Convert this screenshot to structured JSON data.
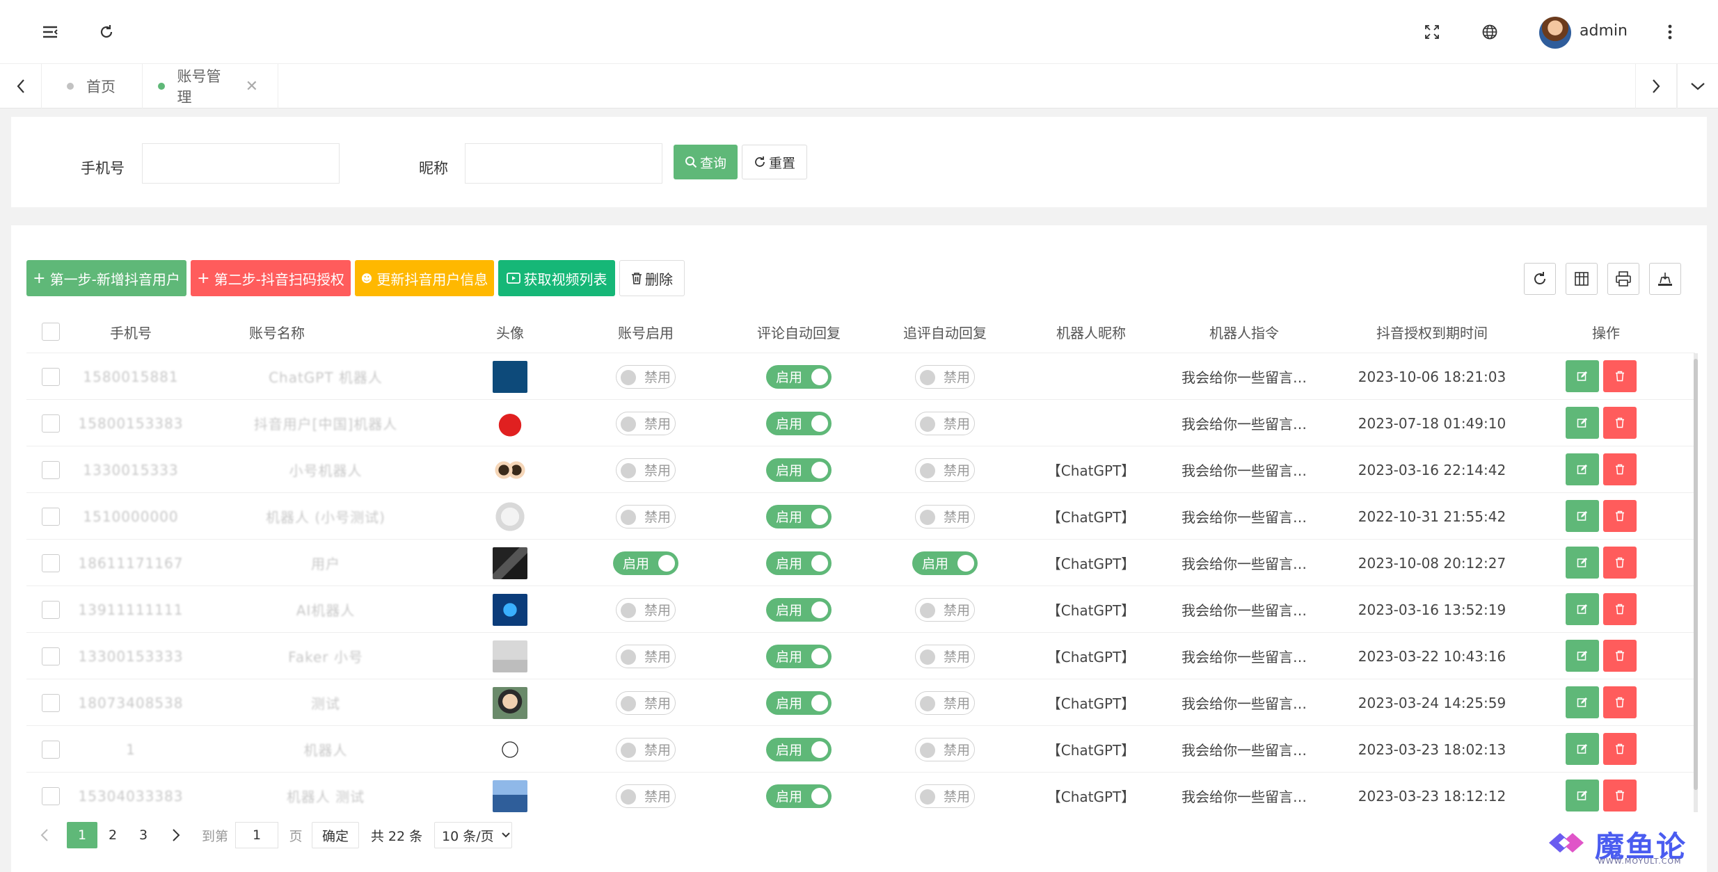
{
  "header": {
    "username": "admin"
  },
  "tabs": [
    {
      "label": "首页",
      "dot_color": "#c2c2c2"
    },
    {
      "label": "账号管理",
      "dot_color": "#5fb878"
    }
  ],
  "search": {
    "phone_label": "手机号",
    "phone_value": "",
    "nickname_label": "昵称",
    "nickname_value": "",
    "query_label": "查询",
    "reset_label": "重置"
  },
  "toolbar": {
    "add_user": "第一步-新增抖音用户",
    "scan_auth": "第二步-抖音扫码授权",
    "update_info": "更新抖音用户信息",
    "fetch_videos": "获取视频列表",
    "delete": "删除"
  },
  "columns": [
    "手机号",
    "账号名称",
    "头像",
    "账号启用",
    "评论自动回复",
    "追评自动回复",
    "机器人昵称",
    "机器人指令",
    "抖音授权到期时间",
    "操作"
  ],
  "rows": [
    {
      "phone": "1580015881",
      "name": "ChatGPT 机器人",
      "avatar": "openai",
      "enable": "禁用",
      "reply": "启用",
      "follow": "禁用",
      "bot": "",
      "cmd": "我会给你一些留言…",
      "expire": "2023-10-06 18:21:03"
    },
    {
      "phone": "15800153383",
      "name": "抖音用户[中国]机器人",
      "avatar": "china",
      "enable": "禁用",
      "reply": "启用",
      "follow": "禁用",
      "bot": "",
      "cmd": "我会给你一些留言…",
      "expire": "2023-07-18 01:49:10"
    },
    {
      "phone": "1330015333",
      "name": "小号机器人",
      "avatar": "couple",
      "enable": "禁用",
      "reply": "启用",
      "follow": "禁用",
      "bot": "【ChatGPT】",
      "cmd": "我会给你一些留言…",
      "expire": "2023-03-16 22:14:42"
    },
    {
      "phone": "1510000000",
      "name": "机器人 (小号测试)",
      "avatar": "girl",
      "enable": "禁用",
      "reply": "启用",
      "follow": "禁用",
      "bot": "【ChatGPT】",
      "cmd": "我会给你一些留言…",
      "expire": "2022-10-31 21:55:42"
    },
    {
      "phone": "18611171167",
      "name": "用户",
      "avatar": "dark",
      "enable": "启用",
      "reply": "启用",
      "follow": "启用",
      "bot": "【ChatGPT】",
      "cmd": "我会给你一些留言…",
      "expire": "2023-10-08 20:12:27"
    },
    {
      "phone": "13911111111",
      "name": "AI机器人",
      "avatar": "ai",
      "enable": "禁用",
      "reply": "启用",
      "follow": "禁用",
      "bot": "【ChatGPT】",
      "cmd": "我会给你一些留言…",
      "expire": "2023-03-16 13:52:19"
    },
    {
      "phone": "13300153333",
      "name": "Faker 小号",
      "avatar": "pose",
      "enable": "禁用",
      "reply": "启用",
      "follow": "禁用",
      "bot": "【ChatGPT】",
      "cmd": "我会给你一些留言…",
      "expire": "2023-03-22 10:43:16"
    },
    {
      "phone": "18073408538",
      "name": "测试",
      "avatar": "glasses",
      "enable": "禁用",
      "reply": "启用",
      "follow": "禁用",
      "bot": "【ChatGPT】",
      "cmd": "我会给你一些留言…",
      "expire": "2023-03-24 14:25:59"
    },
    {
      "phone": "1",
      "name": "机器人",
      "avatar": "sketch",
      "enable": "禁用",
      "reply": "启用",
      "follow": "禁用",
      "bot": "【ChatGPT】",
      "cmd": "我会给你一些留言…",
      "expire": "2023-03-23 18:02:13"
    },
    {
      "phone": "15304033383",
      "name": "机器人 测试",
      "avatar": "sky",
      "enable": "禁用",
      "reply": "启用",
      "follow": "禁用",
      "bot": "【ChatGPT】",
      "cmd": "我会给你一些留言…",
      "expire": "2023-03-23 18:12:12"
    }
  ],
  "pagination": {
    "pages": [
      "1",
      "2",
      "3"
    ],
    "current": "1",
    "goto_label": "到第",
    "goto_value": "1",
    "page_unit": "页",
    "confirm": "确定",
    "total": "共 22 条",
    "page_size": "10 条/页"
  },
  "watermark": {
    "title": "魔鱼论坛",
    "url": "WWW.MOYULT.COM"
  },
  "colors": {
    "primary": "#5fb878",
    "danger": "#ff5c5c",
    "warning": "#ffb800"
  }
}
